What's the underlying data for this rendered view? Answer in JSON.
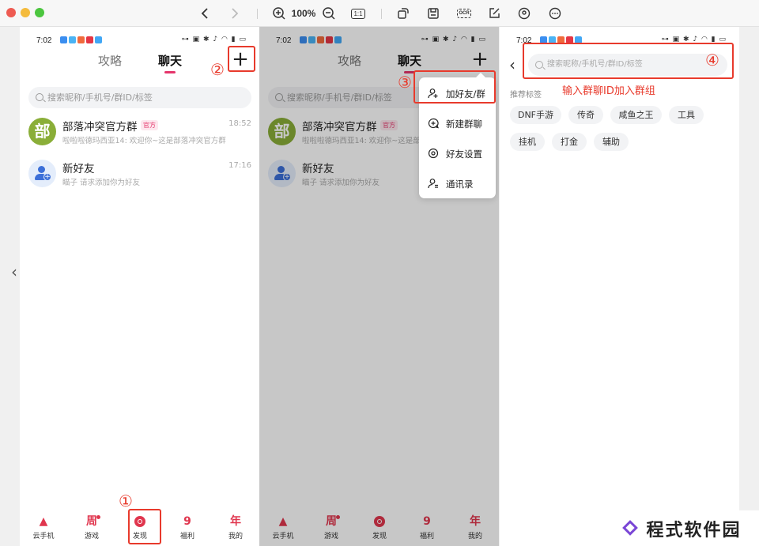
{
  "toolbar": {
    "zoom": "100%",
    "one_to_one": "1:1",
    "ocr": "OCR",
    "traffic_colors": [
      "#ee5b52",
      "#f4bb3c",
      "#4cc63f"
    ]
  },
  "phone": {
    "time": "7:02",
    "status_right": "⊶ ▣ ✱ ♪ ◠ ▮ ▭",
    "app_icon_colors": [
      "#3b8ef0",
      "#4ab3f4",
      "#f06a3c",
      "#e53545",
      "#41a7f5"
    ]
  },
  "panel1": {
    "tabs": [
      {
        "label": "攻略"
      },
      {
        "label": "聊天"
      }
    ],
    "search_placeholder": "搜索昵称/手机号/群ID/标签",
    "chats": [
      {
        "avatar_text": "部",
        "name": "部落冲突官方群",
        "badge": "官方",
        "time": "18:52",
        "preview": "啦啦啦德玛西亚14: 欢迎你~这是部落冲突官方群"
      },
      {
        "avatar_text": "",
        "name": "新好友",
        "badge": "",
        "time": "17:16",
        "preview": "瞄子 请求添加你为好友"
      }
    ],
    "nav": [
      {
        "label": "云手机",
        "icon": "cloud-phone-icon"
      },
      {
        "label": "游戏",
        "icon": "week-icon",
        "glyph": "周"
      },
      {
        "label": "发现",
        "icon": "discover-icon"
      },
      {
        "label": "福利",
        "icon": "welfare-icon",
        "glyph": "9"
      },
      {
        "label": "我的",
        "icon": "profile-icon",
        "glyph": "年"
      }
    ],
    "step_bottom": "①",
    "step_plus": "②"
  },
  "panel2": {
    "tabs": [
      {
        "label": "攻略"
      },
      {
        "label": "聊天"
      }
    ],
    "search_placeholder": "搜索昵称/手机号/群ID/标签",
    "chats": [
      {
        "avatar_text": "部",
        "name": "部落冲突官方群",
        "badge": "官方",
        "preview": "啦啦啦德玛西亚14: 欢迎你~这是部"
      },
      {
        "avatar_text": "",
        "name": "新好友",
        "preview": "瞄子 请求添加你为好友"
      }
    ],
    "menu": [
      {
        "label": "加好友/群",
        "icon": "add-friend-icon"
      },
      {
        "label": "新建群聊",
        "icon": "new-group-icon"
      },
      {
        "label": "好友设置",
        "icon": "friend-settings-icon"
      },
      {
        "label": "通讯录",
        "icon": "contacts-icon"
      }
    ],
    "nav": [
      {
        "label": "云手机"
      },
      {
        "label": "游戏"
      },
      {
        "label": "发现"
      },
      {
        "label": "福利"
      },
      {
        "label": "我的"
      }
    ],
    "step": "③"
  },
  "panel3": {
    "search_placeholder": "搜索昵称/手机号/群ID/标签",
    "annotation": "输入群聊ID加入群组",
    "step": "④",
    "recommended_label": "推荐标签",
    "tags": [
      "DNF手游",
      "传奇",
      "咸鱼之王",
      "工具",
      "挂机",
      "打金",
      "辅助"
    ]
  },
  "watermark": {
    "text": "程式软件园",
    "brand_color": "#7a46d6"
  },
  "colors": {
    "accent": "#e5356b",
    "annotation_red": "#e83a2c",
    "nav_red": "#e0364e"
  }
}
